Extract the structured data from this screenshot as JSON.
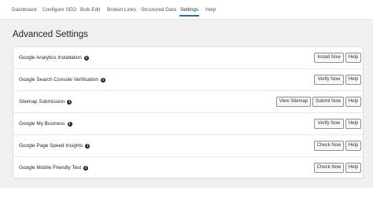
{
  "nav": {
    "tabs": [
      {
        "label": "Dashboard"
      },
      {
        "label": "Configure SEO"
      },
      {
        "label": "Bulk Edit"
      },
      {
        "label": "Broken Links"
      },
      {
        "label": "Structured Data"
      },
      {
        "label": "Settings"
      },
      {
        "label": "Help"
      }
    ],
    "active": "Settings"
  },
  "page": {
    "title": "Advanced Settings"
  },
  "rows": [
    {
      "label": "Google Analytics Installation",
      "actions": [
        "Install Now",
        "Help"
      ]
    },
    {
      "label": "Google Search Console Verification",
      "actions": [
        "Verify Now",
        "Help"
      ]
    },
    {
      "label": "Sitemap Submission",
      "actions": [
        "View Sitemap",
        "Submit Now",
        "Help"
      ]
    },
    {
      "label": "Google My Business",
      "actions": [
        "Verify Now",
        "Help"
      ]
    },
    {
      "label": "Google Page Speed Insights",
      "actions": [
        "Check Now",
        "Help"
      ]
    },
    {
      "label": "Google Mobile Friendly Test",
      "actions": [
        "Check Now",
        "Help"
      ]
    }
  ],
  "icons": {
    "info": "info-circle-icon"
  },
  "colors": {
    "accent": "#2271b1",
    "background": "#f0f0f1"
  }
}
